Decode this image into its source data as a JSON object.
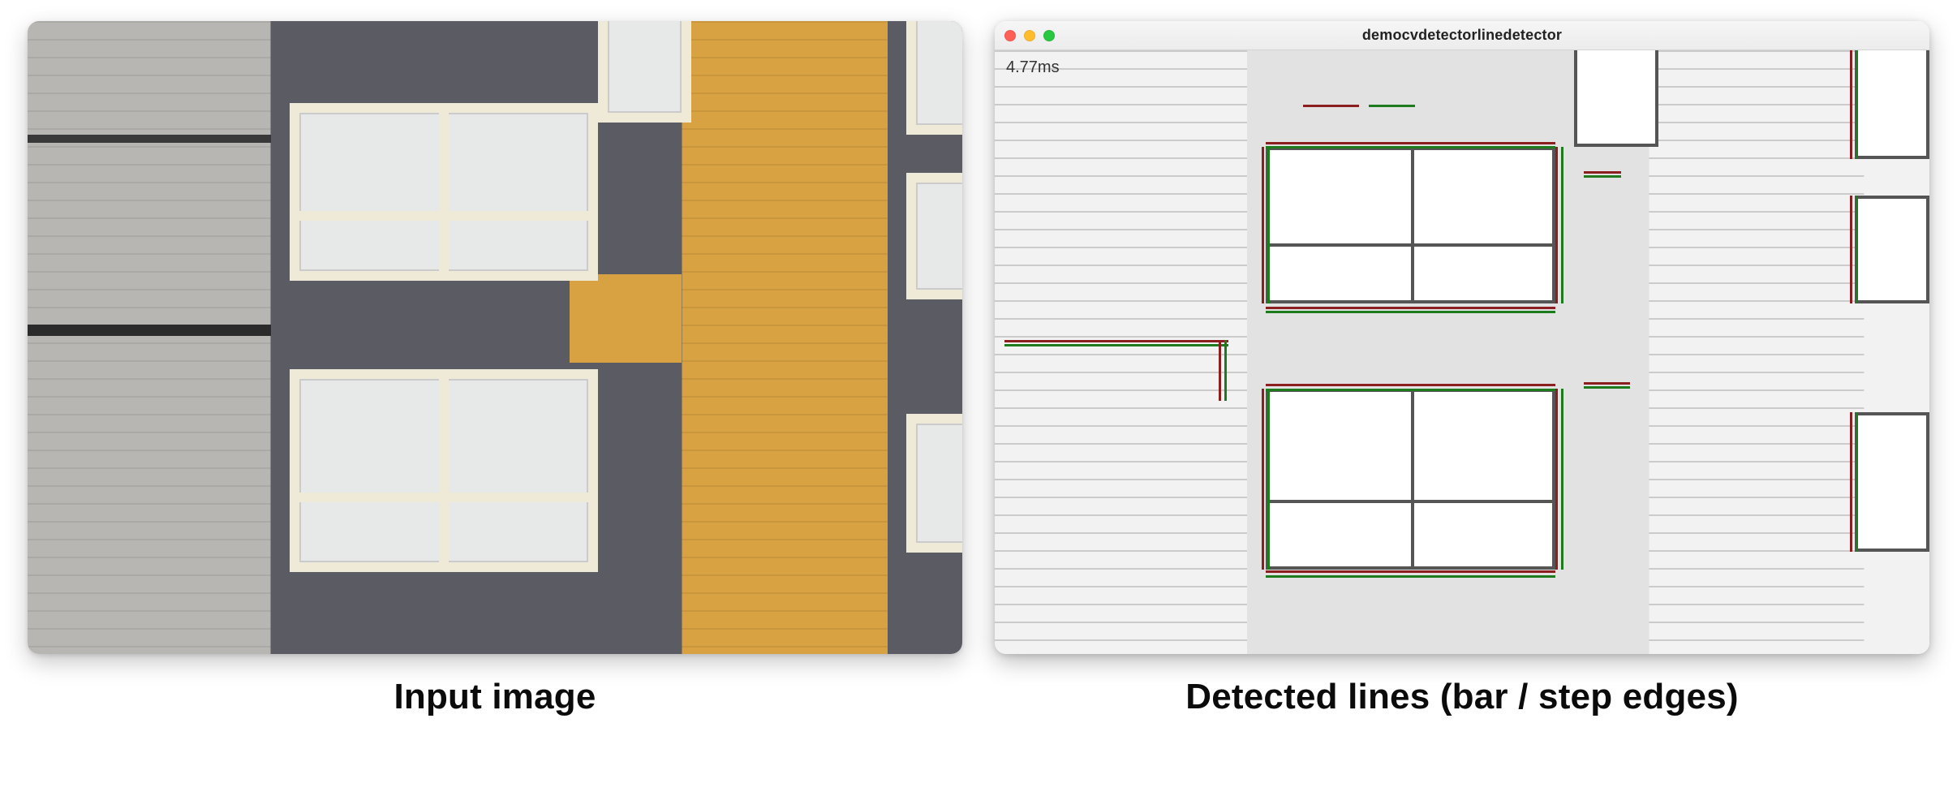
{
  "figure": {
    "left_caption": "Input image",
    "right_caption": "Detected lines (bar / step edges)",
    "left_alt": "Photograph of a building façade with grey and mustard-yellow siding and two large windows.",
    "right_alt": "Line-detection output rendered over a desaturated version of the same façade; grey strokes mark step edges, dark-red and green strokes mark bar edges."
  },
  "window": {
    "title": "democvdetectorlinedetector",
    "timing_label": "4.77ms",
    "traffic_light_close": "Close",
    "traffic_light_min": "Minimize",
    "traffic_light_max": "Zoom"
  },
  "detector": {
    "legend": {
      "step_edge_color": "grey",
      "bar_edge_colors": [
        "dark red",
        "green"
      ]
    }
  }
}
